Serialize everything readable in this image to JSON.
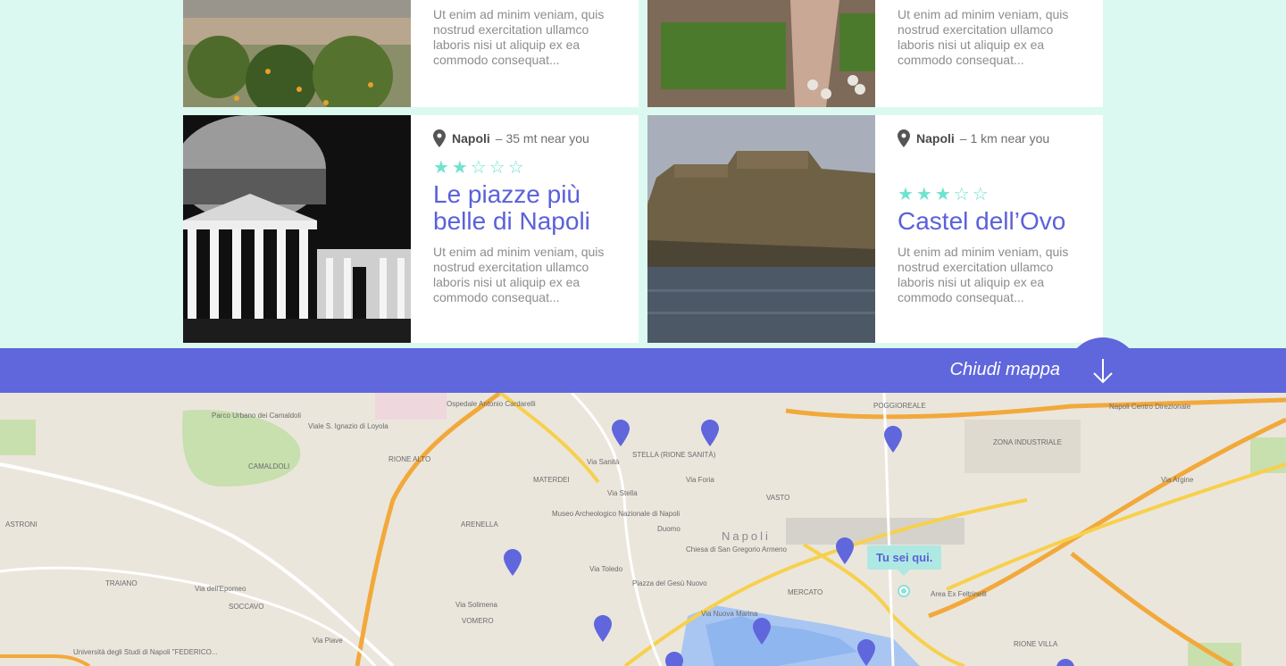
{
  "cards": [
    {
      "desc": "Ut enim ad minim veniam, quis nostrud exercitation ullamco laboris nisi ut aliquip ex ea commodo consequat..."
    },
    {
      "desc": "Ut enim ad minim veniam, quis nostrud exercitation ullamco laboris nisi ut aliquip ex ea commodo consequat..."
    },
    {
      "city": "Napoli",
      "distance": "– 35 mt near you",
      "stars": "★★☆☆☆",
      "rating": 2,
      "title": "Le piazze più belle di Napoli",
      "desc": "Ut enim ad minim veniam, quis nostrud exercitation ullamco laboris nisi ut aliquip ex ea commodo consequat..."
    },
    {
      "city": "Napoli",
      "distance": "– 1 km near you",
      "stars": "★★★☆☆",
      "rating": 3,
      "title": "Castel dell’Ovo",
      "desc": "Ut enim ad minim veniam, quis nostrud exercitation ullamco laboris nisi ut aliquip ex ea commodo consequat..."
    }
  ],
  "map_bar": {
    "label": "Chiudi mappa",
    "icon": "arrow-down-icon"
  },
  "map": {
    "tooltip": "Tu sei qui.",
    "labels": {
      "parco": "Parco Urbano dei Camaldoli",
      "camaldoli": "CAMALDOLI",
      "ospedale": "Ospedale Antonio Cardarelli",
      "rione": "RIONE ALTO",
      "stella": "STELLA (RIONE SANITÀ)",
      "materdei": "MATERDEI",
      "arenella": "ARENELLA",
      "museo": "Museo Archeologico Nazionale di Napoli",
      "duomo": "Duomo",
      "chiesa": "Chiesa di San Gregorio Armeno",
      "napoli": "Napoli",
      "vasto": "VASTO",
      "poggioreale": "POGGIOREALE",
      "zona": "ZONA INDUSTRIALE",
      "mercato": "MERCATO",
      "piazza": "Piazza del Gesù Nuovo",
      "vomero": "VOMERO",
      "soccavo": "SOCCAVO",
      "traiano": "TRAIANO",
      "astroni": "ASTRONI",
      "area": "Area Ex Feltrinelli",
      "rione_villa": "RIONE VILLA",
      "universita": "Università degli Studi di Napoli \"FEDERICO...",
      "centro": "Napoli Centro Direzionale",
      "via_nuova_marina": "Via Nuova Marina",
      "via_foria": "Via Foria",
      "via_argine": "Via Argine",
      "via_epomeo": "Via dell'Epomeo",
      "via_toledo": "Via Toledo",
      "via_solimena": "Via Solimena",
      "via_piave": "Via Piave",
      "via_stella": "Via Stella",
      "via_sanita": "Via Sanità",
      "via_loyola": "Viale S. Ignazio di Loyola"
    }
  },
  "colors": {
    "accent": "#5b61d9",
    "bar": "#6066dc",
    "star": "#6fe3cf",
    "page_bg": "#dcf9f1"
  }
}
